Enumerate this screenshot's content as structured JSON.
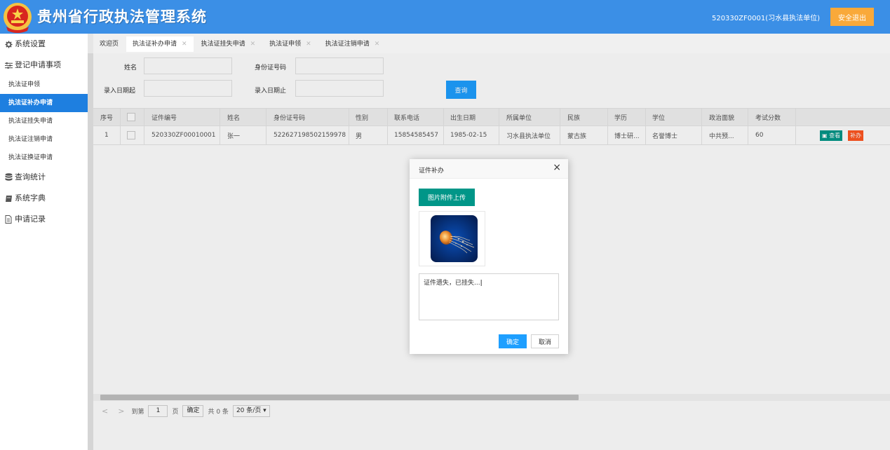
{
  "header": {
    "title": "贵州省行政执法管理系统",
    "user": "520330ZF0001(习水县执法单位)",
    "logout_label": "安全退出",
    "emblem_icon": "national-emblem-icon",
    "bg_color": "#3b8fe6"
  },
  "sidebar": {
    "groups": [
      {
        "label": "系统设置",
        "icon": "gear-icon"
      },
      {
        "label": "登记申请事项",
        "icon": "sliders-icon"
      },
      {
        "label": "查询统计",
        "icon": "database-icon"
      },
      {
        "label": "系统字典",
        "icon": "book-icon"
      },
      {
        "label": "申请记录",
        "icon": "document-icon"
      }
    ],
    "items": [
      {
        "label": "执法证申领"
      },
      {
        "label": "执法证补办申请"
      },
      {
        "label": "执法证挂失申请"
      },
      {
        "label": "执法证注销申请"
      },
      {
        "label": "执法证换证申请"
      }
    ],
    "active_item": "执法证补办申请",
    "active_color": "#1e7fe0"
  },
  "tabs": [
    {
      "label": "欢迎页"
    },
    {
      "label": "执法证补办申请"
    },
    {
      "label": "执法证挂失申请"
    },
    {
      "label": "执法证申领"
    },
    {
      "label": "执法证注销申请"
    }
  ],
  "search": {
    "name_label": "姓名",
    "id_label": "身份证号码",
    "date_start_label": "录入日期起",
    "date_end_label": "录入日期止",
    "query_label": "查询"
  },
  "table": {
    "headers": [
      "序号",
      "证件编号",
      "姓名",
      "身份证号码",
      "性别",
      "联系电话",
      "出生日期",
      "所属单位",
      "民族",
      "学历",
      "学位",
      "政治面貌",
      "考试分数"
    ],
    "rows": [
      [
        "1",
        "520330ZF00010001",
        "张一",
        "522627198502159978",
        "男",
        "15854585457",
        "1985-02-15",
        "习水县执法单位",
        "蒙古族",
        "博士研...",
        "名誉博士",
        "中共预...",
        "60"
      ]
    ],
    "view_label": "查看",
    "supplement_label": "补办"
  },
  "pager": {
    "prev": "<",
    "next": ">",
    "goto_label": "到第",
    "page_value": "1",
    "page_unit": "页",
    "confirm_label": "确定",
    "total_label": "共 0 条",
    "page_size": "20 条/页"
  },
  "modal": {
    "title": "证件补办",
    "close": "×",
    "upload_label": "图片附件上传",
    "remark_text": "证件遗失，已挂失...",
    "ok_label": "确定",
    "cancel_label": "取消"
  }
}
